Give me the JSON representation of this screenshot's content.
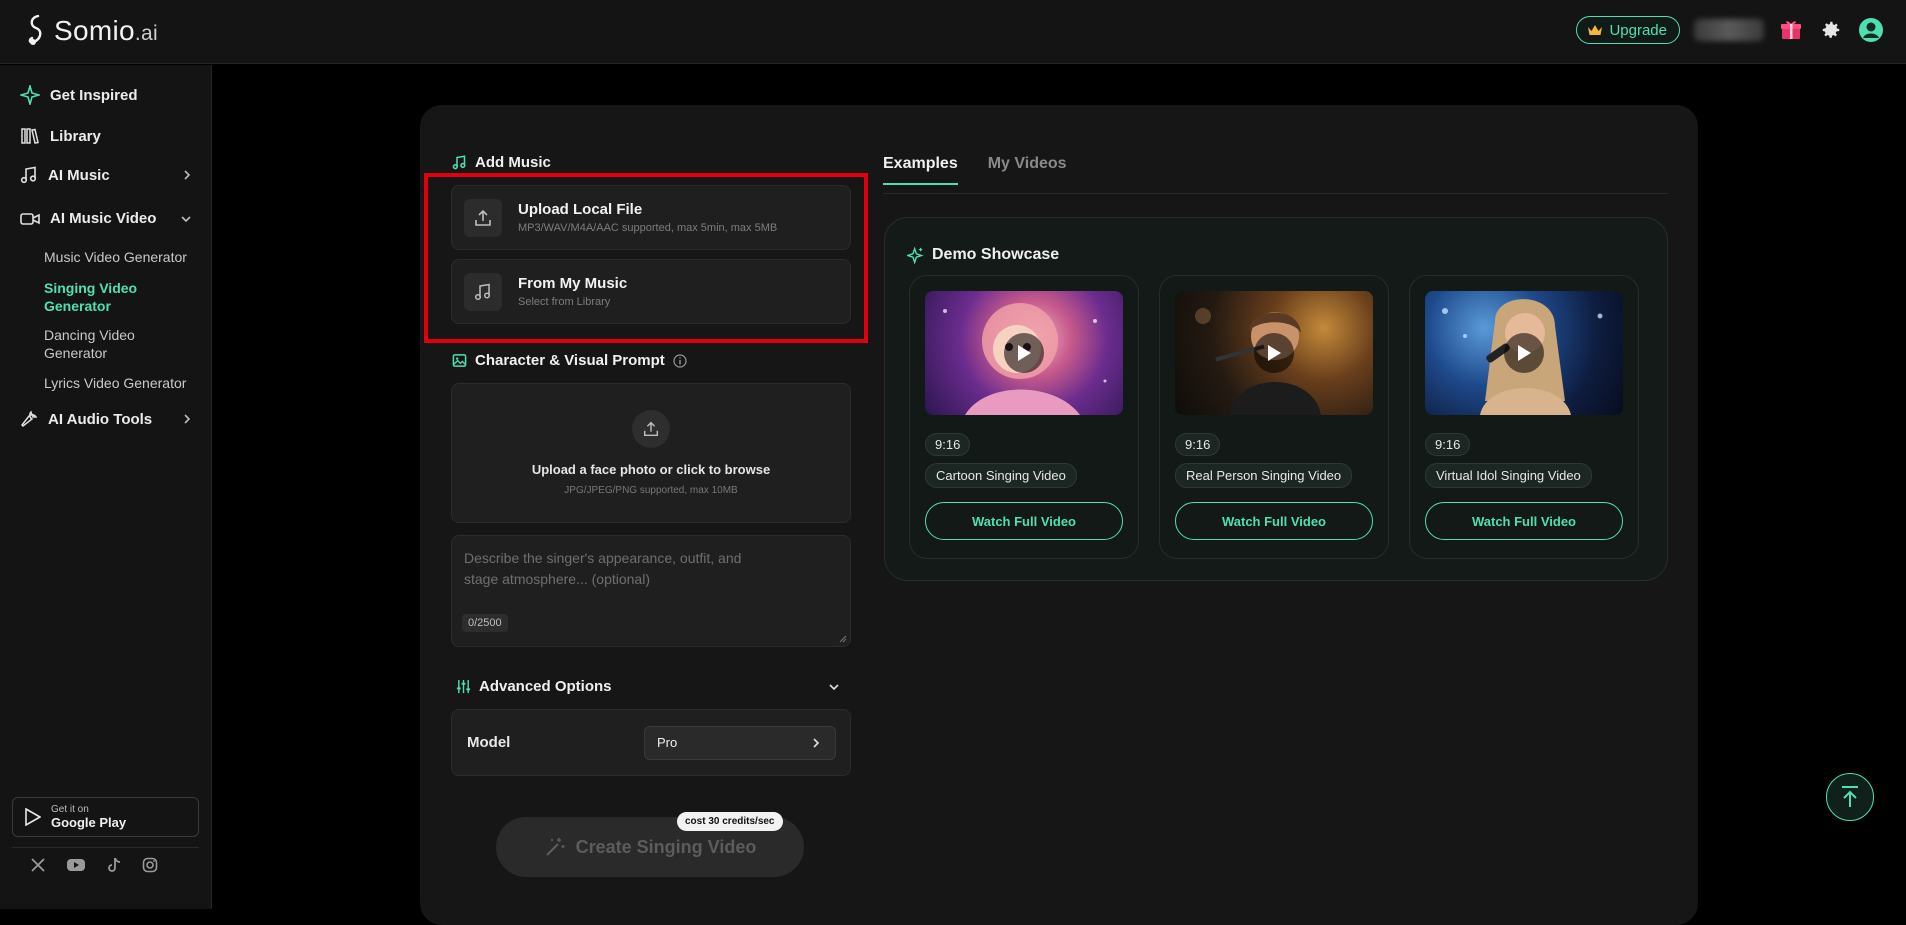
{
  "app": {
    "logo_main": "Somio",
    "logo_suffix": ".ai"
  },
  "topbar": {
    "upgrade_label": "Upgrade"
  },
  "sidebar": {
    "items": [
      {
        "label": "Get Inspired"
      },
      {
        "label": "Library"
      },
      {
        "label": "AI Music"
      },
      {
        "label": "AI Music Video"
      },
      {
        "label": "AI Audio Tools"
      }
    ],
    "subitems": [
      {
        "label": "Music Video Generator"
      },
      {
        "label": "Singing Video Generator"
      },
      {
        "label": "Dancing Video Generator"
      },
      {
        "label": "Lyrics Video Generator"
      }
    ],
    "gplay_small": "Get it on",
    "gplay_big": "Google Play"
  },
  "left": {
    "add_music_title": "Add Music",
    "upload_title": "Upload Local File",
    "upload_sub": "MP3/WAV/M4A/AAC supported, max 5min, max 5MB",
    "mymusic_title": "From My Music",
    "mymusic_sub": "Select from Library",
    "character_title": "Character & Visual Prompt",
    "face_title": "Upload a face photo or click to browse",
    "face_sub": "JPG/JPEG/PNG supported, max 10MB",
    "prompt_placeholder": "Describe the singer's appearance, outfit, and stage atmosphere... (optional)",
    "counter": "0/2500",
    "advanced_title": "Advanced Options",
    "model_label": "Model",
    "model_value": "Pro",
    "create_label": "Create Singing Video",
    "cost_badge": "cost 30 credits/sec"
  },
  "right": {
    "tabs": [
      {
        "label": "Examples"
      },
      {
        "label": "My Videos"
      }
    ],
    "showcase_title": "Demo Showcase",
    "videos": [
      {
        "ratio": "9:16",
        "label": "Cartoon Singing Video",
        "watch": "Watch Full Video"
      },
      {
        "ratio": "9:16",
        "label": "Real Person Singing Video",
        "watch": "Watch Full Video"
      },
      {
        "ratio": "9:16",
        "label": "Virtual Idol Singing Video",
        "watch": "Watch Full Video"
      }
    ]
  },
  "colors": {
    "accent": "#4fe0b2",
    "highlight_box": "#e0000f"
  }
}
